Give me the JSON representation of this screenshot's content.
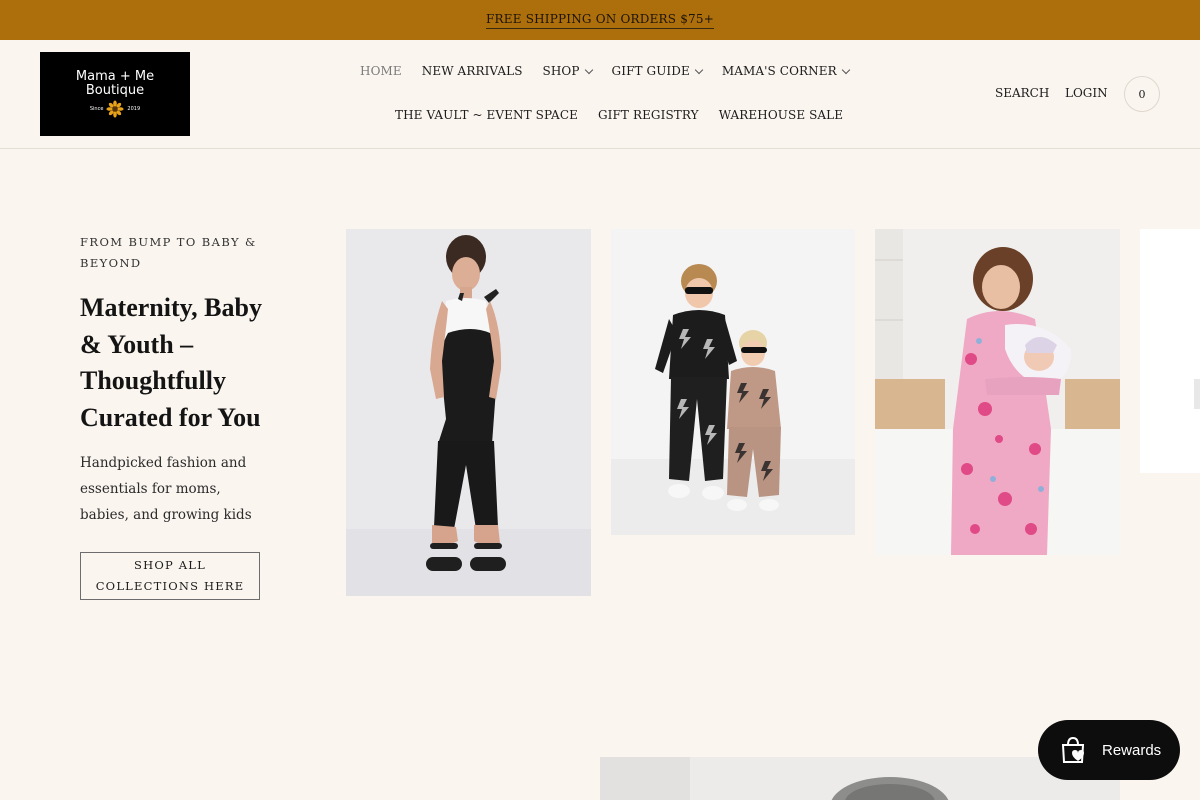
{
  "announcement": {
    "text": "FREE SHIPPING ON ORDERS $75+"
  },
  "logo": {
    "line1": "Mama + Me",
    "line2": "Boutique",
    "since": "Since",
    "year": "2019"
  },
  "nav": {
    "row1": [
      {
        "label": "HOME",
        "active": true,
        "dropdown": false
      },
      {
        "label": "NEW ARRIVALS",
        "dropdown": false
      },
      {
        "label": "SHOP",
        "dropdown": true
      },
      {
        "label": "GIFT GUIDE",
        "dropdown": true
      },
      {
        "label": "MAMA'S CORNER",
        "dropdown": true
      }
    ],
    "row2": [
      {
        "label": "THE VAULT ~ EVENT SPACE"
      },
      {
        "label": "GIFT REGISTRY"
      },
      {
        "label": "WAREHOUSE SALE"
      }
    ]
  },
  "header_utils": {
    "search": "SEARCH",
    "login": "LOGIN",
    "cart_count": "0"
  },
  "hero": {
    "eyebrow": "FROM BUMP TO BABY & BEYOND",
    "headline": "Maternity, Baby & Youth – Thoughtfully Curated for You",
    "description": "Handpicked fashion and essentials for moms, babies, and growing kids",
    "cta": "SHOP ALL COLLECTIONS HERE"
  },
  "rewards": {
    "label": "Rewards"
  },
  "colors": {
    "announcement_bg": "#ad6f0b",
    "page_bg": "#faf5ef",
    "rewards_bg": "#0d0d0d"
  }
}
